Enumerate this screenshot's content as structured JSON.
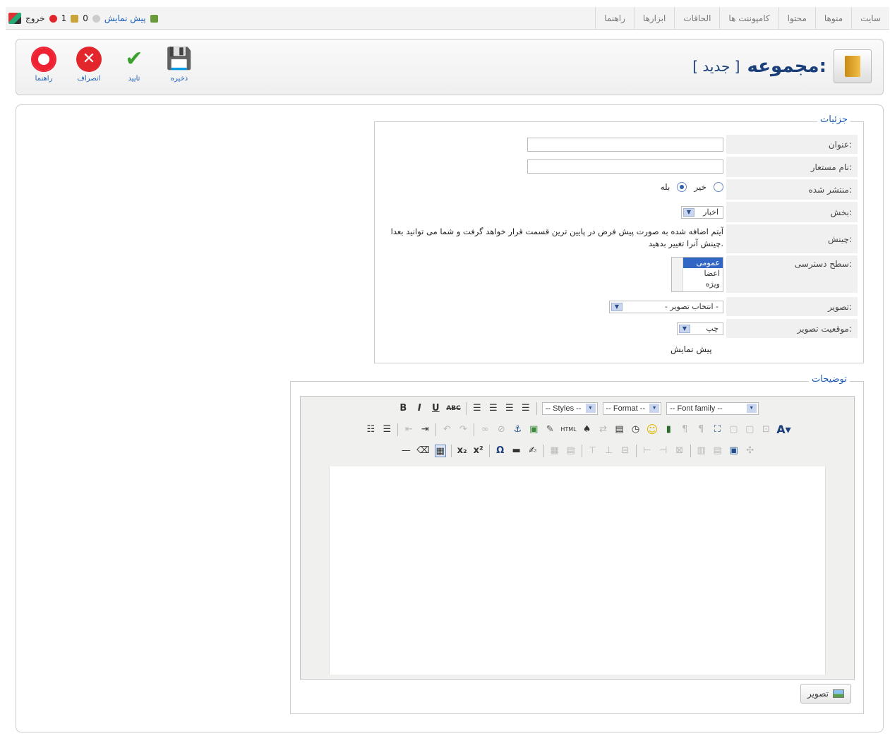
{
  "topmenu": {
    "items": [
      "سایت",
      "منوها",
      "محتوا",
      "کامپوننت ها",
      "الحاقات",
      "ابزارها",
      "راهنما"
    ]
  },
  "status": {
    "logout": "خروج",
    "messages": "1",
    "users": "0",
    "preview": "پیش نمایش"
  },
  "header": {
    "title": "مجموعه:",
    "subtitle": "[ جدید ]"
  },
  "toolbar": {
    "save": "ذخیره",
    "apply": "تایید",
    "cancel": "انصراف",
    "help": "راهنما"
  },
  "details": {
    "legend": "جزئیات",
    "title_label": "عنوان:",
    "title_value": "",
    "alias_label": "نام مستعار:",
    "alias_value": "",
    "published_label": "منتشر شده:",
    "published_no": "خیر",
    "published_yes": "بله",
    "section_label": "بخش:",
    "section_value": "اخبار",
    "order_label": "چینش:",
    "order_text": "آیتم اضافه شده به صورت پیش فرض در پایین ترین قسمت قرار خواهد گرفت و شما می توانید بعدا چینش آنرا تغییر بدهید.",
    "access_label": "سطح دسترسی:",
    "access_options": [
      "عمومی",
      "اعضا",
      "ویژه"
    ],
    "image_label": "تصویر:",
    "image_value": "- انتخاب تصویر -",
    "image_pos_label": "موقعیت تصویر:",
    "image_pos_value": "چپ",
    "preview": "پیش نمایش"
  },
  "description": {
    "legend": "توضیحات",
    "styles": "-- Styles --",
    "format": "-- Format --",
    "font_family": "-- Font family --",
    "image_button": "تصویر"
  }
}
